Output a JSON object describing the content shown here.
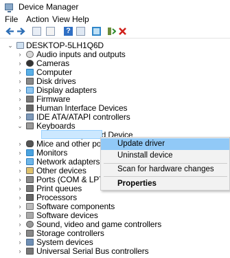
{
  "window": {
    "title": "Device Manager"
  },
  "menu": [
    "File",
    "Action",
    "View",
    "Help"
  ],
  "toolbar_icons": [
    "back-arrow-icon",
    "forward-arrow-icon",
    "properties-icon",
    "show-hidden-icon",
    "help-icon",
    "computer-view-icon",
    "monitor-icon",
    "update-driver-icon",
    "uninstall-icon"
  ],
  "tree": {
    "root": "DESKTOP-5LH1Q6D",
    "items": [
      "Audio inputs and outputs",
      "Cameras",
      "Computer",
      "Disk drives",
      "Display adapters",
      "Firmware",
      "Human Interface Devices",
      "IDE ATA/ATAPI controllers",
      "Keyboards",
      "HID Keyboard Device",
      "Mice and other pointing",
      "Monitors",
      "Network adapters",
      "Other devices",
      "Ports (COM & LPT)",
      "Print queues",
      "Processors",
      "Software components",
      "Software devices",
      "Sound, video and game controllers",
      "Storage controllers",
      "System devices",
      "Universal Serial Bus controllers"
    ]
  },
  "context_menu": {
    "update": "Update driver",
    "uninstall": "Uninstall device",
    "scan": "Scan for hardware changes",
    "properties": "Properties"
  },
  "colors": {
    "selection": "#cce8ff",
    "menu_highlight": "#91c9f7"
  }
}
